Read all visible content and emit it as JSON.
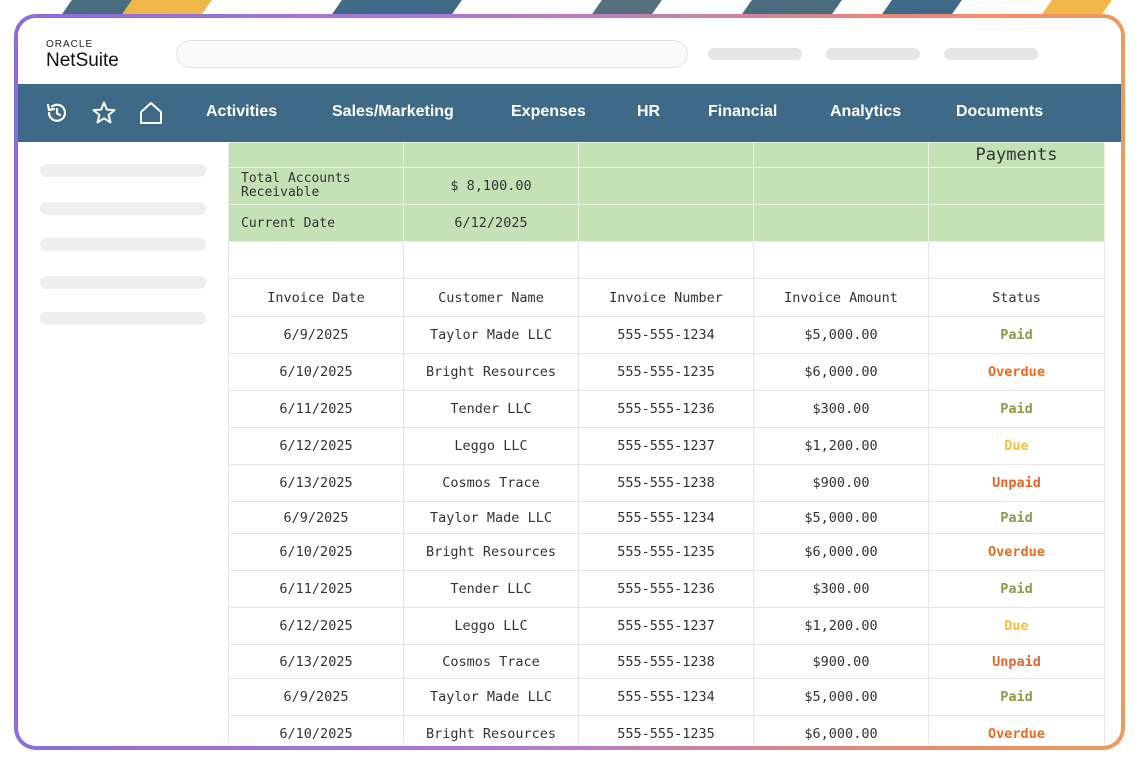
{
  "app": {
    "logo_top": "ORACLE",
    "logo_main": "NetSuite"
  },
  "nav": {
    "icons": [
      "history-icon",
      "star-icon",
      "home-icon"
    ],
    "items": [
      "Activities",
      "Sales/Marketing",
      "Expenses",
      "HR",
      "Financial",
      "Analytics",
      "Documents"
    ]
  },
  "summary": {
    "payments_heading": "Payments",
    "total_label": "Total Accounts Receivable",
    "total_value": "$ 8,100.00",
    "date_label": "Current Date",
    "date_value": "6/12/2025"
  },
  "table": {
    "headers": [
      "Invoice Date",
      "Customer Name",
      "Invoice Number",
      "Invoice Amount",
      "Status"
    ],
    "rows": [
      [
        "6/9/2025",
        "Taylor Made LLC",
        "555-555-1234",
        "$5,000.00",
        "Paid"
      ],
      [
        "6/10/2025",
        "Bright Resources",
        "555-555-1235",
        "$6,000.00",
        "Overdue"
      ],
      [
        "6/11/2025",
        "Tender LLC",
        "555-555-1236",
        "$300.00",
        "Paid"
      ],
      [
        "6/12/2025",
        "Leggo LLC",
        "555-555-1237",
        "$1,200.00",
        "Due"
      ],
      [
        "6/13/2025",
        "Cosmos Trace",
        "555-555-1238",
        "$900.00",
        "Unpaid"
      ],
      [
        "6/9/2025",
        "Taylor Made LLC",
        "555-555-1234",
        "$5,000.00",
        "Paid"
      ],
      [
        "6/10/2025",
        "Bright Resources",
        "555-555-1235",
        "$6,000.00",
        "Overdue"
      ],
      [
        "6/11/2025",
        "Tender LLC",
        "555-555-1236",
        "$300.00",
        "Paid"
      ],
      [
        "6/12/2025",
        "Leggo LLC",
        "555-555-1237",
        "$1,200.00",
        "Due"
      ],
      [
        "6/13/2025",
        "Cosmos Trace",
        "555-555-1238",
        "$900.00",
        "Unpaid"
      ],
      [
        "6/9/2025",
        "Taylor Made LLC",
        "555-555-1234",
        "$5,000.00",
        "Paid"
      ],
      [
        "6/10/2025",
        "Bright Resources",
        "555-555-1235",
        "$6,000.00",
        "Overdue"
      ]
    ]
  },
  "colors": {
    "nav_bg": "#3f6a87",
    "summary_green": "#c5e2b6",
    "status_paid": "#8a9a4a",
    "status_overdue": "#ec6a1c",
    "status_due": "#f2c23c",
    "status_unpaid": "#e8642a"
  }
}
